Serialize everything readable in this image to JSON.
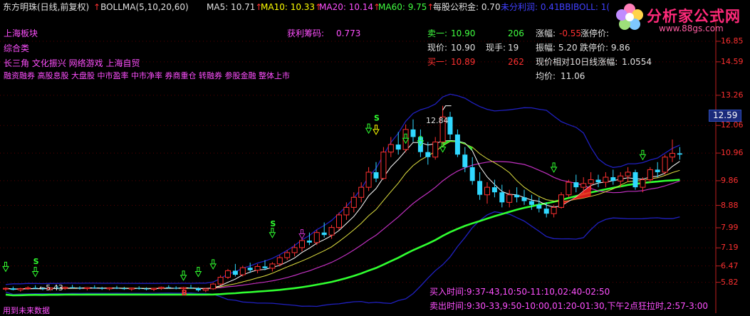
{
  "header": {
    "stock_name": "东方明珠(日线,前复权)",
    "indicator": "BOLLMA(5,10,20,60)",
    "ma5": "MA5: 10.71",
    "ma10": "MA10: 10.33",
    "ma20": "MA20: 10.14",
    "ma60": "MA60: 9.75",
    "gongjijin": "每股公积金: 0.70",
    "weifenpei": "未分利润: 0.41",
    "bbiboll": "BBIBOLL: 1("
  },
  "logo": {
    "title": "分析家公式网",
    "url": "www.88gs.com"
  },
  "left_info": {
    "board": "上海板块",
    "category": "综合类",
    "concepts1": "长三角  文化振兴  网络游戏  上海自贸",
    "concepts2": "融资融券  高股息股  大盘股  中市盈率  中市净率  券商重仓  转融券  参股金融  整体上市",
    "chip_label": "获利筹码:",
    "chip_value": "0.773"
  },
  "quote": {
    "sell1_label": "卖一:",
    "sell1_price": "10.90",
    "sell1_vol": "206",
    "now_label": "现价:",
    "now_price": "10.90",
    "hand_label": "现手:",
    "hand_value": "19",
    "buy1_label": "买一:",
    "buy1_price": "10.89",
    "buy1_vol": "262",
    "limitup_label": "涨幅:",
    "limitup_value": "-0.55",
    "limitprice_label": "涨停价:",
    "amplitude": "振幅: 5.20",
    "limitdown": "跌停价: 9.86",
    "rel10": "现价相对10日线涨幅:",
    "rel10_value": "1.0554",
    "avg_label": "均价:",
    "avg_value": "11.06"
  },
  "annotations": {
    "high_label": "12.84",
    "low_label": "5.43",
    "buy_time": "买入时间:9:37-43,10:50-11:10,02:40-02:50",
    "sell_time": "卖出时间:9:30-33,9:50-10:00,01:20-01:30,下午2点狂拉时,2:57-3:00",
    "bottom_left": "用到未来数据"
  },
  "price_badge": "12.59",
  "chart_data": {
    "type": "candlestick",
    "title": "",
    "ylim": [
      5.3,
      16.2
    ],
    "y_ticks": [
      "16.85",
      "14.59",
      "13.26",
      "12.06",
      "10.96",
      "9.86",
      "8.88",
      "7.99",
      "7.19",
      "6.47",
      "5.82"
    ],
    "candles": [
      [
        5.55,
        5.62,
        5.48,
        5.58
      ],
      [
        5.58,
        5.65,
        5.5,
        5.52
      ],
      [
        5.52,
        5.6,
        5.45,
        5.57
      ],
      [
        5.57,
        5.66,
        5.52,
        5.6
      ],
      [
        5.6,
        5.7,
        5.55,
        5.58
      ],
      [
        5.58,
        5.63,
        5.5,
        5.55
      ],
      [
        5.55,
        5.62,
        5.48,
        5.6
      ],
      [
        5.6,
        5.68,
        5.55,
        5.58
      ],
      [
        5.58,
        5.65,
        5.52,
        5.62
      ],
      [
        5.62,
        5.72,
        5.58,
        5.6
      ],
      [
        5.6,
        5.66,
        5.53,
        5.57
      ],
      [
        5.57,
        5.63,
        5.5,
        5.61
      ],
      [
        5.61,
        5.7,
        5.56,
        5.59
      ],
      [
        5.59,
        5.64,
        5.52,
        5.56
      ],
      [
        5.56,
        5.62,
        5.5,
        5.6
      ],
      [
        5.6,
        5.68,
        5.55,
        5.58
      ],
      [
        5.58,
        5.64,
        5.52,
        5.55
      ],
      [
        5.55,
        5.61,
        5.48,
        5.59
      ],
      [
        5.59,
        5.66,
        5.53,
        5.57
      ],
      [
        5.57,
        5.62,
        5.5,
        5.54
      ],
      [
        5.54,
        5.6,
        5.47,
        5.58
      ],
      [
        5.58,
        5.65,
        5.52,
        5.62
      ],
      [
        5.62,
        5.7,
        5.57,
        5.6
      ],
      [
        5.6,
        5.66,
        5.54,
        5.57
      ],
      [
        5.57,
        5.64,
        5.5,
        5.61
      ],
      [
        5.61,
        5.72,
        5.56,
        5.58
      ],
      [
        5.58,
        5.62,
        5.45,
        5.5
      ],
      [
        5.5,
        5.6,
        5.43,
        5.56
      ],
      [
        5.56,
        5.8,
        5.52,
        5.75
      ],
      [
        5.75,
        6.1,
        5.7,
        6.02
      ],
      [
        6.02,
        6.35,
        5.95,
        6.28
      ],
      [
        6.28,
        6.55,
        6.05,
        6.12
      ],
      [
        6.12,
        6.48,
        6.05,
        6.4
      ],
      [
        6.4,
        6.6,
        6.2,
        6.3
      ],
      [
        6.3,
        6.55,
        6.18,
        6.45
      ],
      [
        6.45,
        6.7,
        6.3,
        6.38
      ],
      [
        6.38,
        6.62,
        6.25,
        6.55
      ],
      [
        6.55,
        6.9,
        6.45,
        6.8
      ],
      [
        6.8,
        7.1,
        6.7,
        7.0
      ],
      [
        7.0,
        7.35,
        6.85,
        7.2
      ],
      [
        7.2,
        7.6,
        7.05,
        7.48
      ],
      [
        7.48,
        7.8,
        7.3,
        7.4
      ],
      [
        7.4,
        7.9,
        7.3,
        7.8
      ],
      [
        7.8,
        8.2,
        7.6,
        7.7
      ],
      [
        7.7,
        8.1,
        7.55,
        8.0
      ],
      [
        8.0,
        8.6,
        7.9,
        8.5
      ],
      [
        8.5,
        9.0,
        8.3,
        8.8
      ],
      [
        8.8,
        9.4,
        8.6,
        9.2
      ],
      [
        9.2,
        9.8,
        9.0,
        9.6
      ],
      [
        9.6,
        10.4,
        9.45,
        10.2
      ],
      [
        10.2,
        10.6,
        9.8,
        9.95
      ],
      [
        9.95,
        11.2,
        9.9,
        11.0
      ],
      [
        11.0,
        11.6,
        10.8,
        11.3
      ],
      [
        11.3,
        11.8,
        10.9,
        11.1
      ],
      [
        11.1,
        12.1,
        11.0,
        11.9
      ],
      [
        11.9,
        12.3,
        11.4,
        11.6
      ],
      [
        11.6,
        11.9,
        10.8,
        11.0
      ],
      [
        11.0,
        11.4,
        10.5,
        10.8
      ],
      [
        10.8,
        11.6,
        10.7,
        11.4
      ],
      [
        11.4,
        12.84,
        11.3,
        12.4
      ],
      [
        12.4,
        12.6,
        11.5,
        11.7
      ],
      [
        11.7,
        11.9,
        10.8,
        10.9
      ],
      [
        10.9,
        11.2,
        10.2,
        10.4
      ],
      [
        10.4,
        10.8,
        9.7,
        9.85
      ],
      [
        9.85,
        10.2,
        9.1,
        9.3
      ],
      [
        9.3,
        9.8,
        8.95,
        9.6
      ],
      [
        9.6,
        9.9,
        9.2,
        9.4
      ],
      [
        9.4,
        9.7,
        8.8,
        9.0
      ],
      [
        9.0,
        9.5,
        8.8,
        9.3
      ],
      [
        9.3,
        9.6,
        9.0,
        9.2
      ],
      [
        9.2,
        9.5,
        8.9,
        9.05
      ],
      [
        9.05,
        9.3,
        8.7,
        8.9
      ],
      [
        8.9,
        9.2,
        8.6,
        8.75
      ],
      [
        8.75,
        9.0,
        8.4,
        8.55
      ],
      [
        8.55,
        8.9,
        8.4,
        8.8
      ],
      [
        8.8,
        9.4,
        8.75,
        9.3
      ],
      [
        9.3,
        9.9,
        9.2,
        9.8
      ],
      [
        9.8,
        10.1,
        9.4,
        9.6
      ],
      [
        9.6,
        10.0,
        9.3,
        9.75
      ],
      [
        9.75,
        10.2,
        9.5,
        9.9
      ],
      [
        9.9,
        10.1,
        9.6,
        9.8
      ],
      [
        9.8,
        10.2,
        9.6,
        10.0
      ],
      [
        10.0,
        10.3,
        9.7,
        9.85
      ],
      [
        9.85,
        10.2,
        9.6,
        10.05
      ],
      [
        10.05,
        10.4,
        9.8,
        10.2
      ],
      [
        10.2,
        10.3,
        9.5,
        9.6
      ],
      [
        9.6,
        10.0,
        9.4,
        9.9
      ],
      [
        9.9,
        10.4,
        9.8,
        10.3
      ],
      [
        10.3,
        10.6,
        10.0,
        10.2
      ],
      [
        10.2,
        10.9,
        10.1,
        10.8
      ],
      [
        10.8,
        11.5,
        10.6,
        10.95
      ],
      [
        10.95,
        11.2,
        10.7,
        10.9
      ]
    ]
  }
}
